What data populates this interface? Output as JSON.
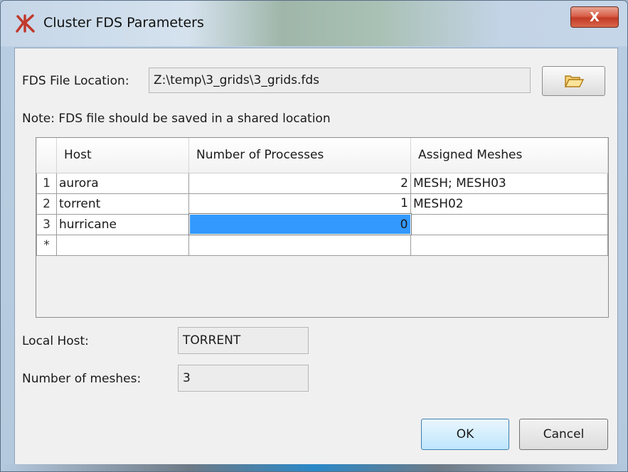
{
  "window": {
    "title": "Cluster FDS Parameters",
    "close_label": "X"
  },
  "fds_file": {
    "label": "FDS File Location:",
    "value": "Z:\\temp\\3_grids\\3_grids.fds",
    "browse_icon": "folder-open-icon"
  },
  "note": "Note: FDS file should be saved in a shared location",
  "table": {
    "columns": [
      "Host",
      "Number of Processes",
      "Assigned Meshes"
    ],
    "rows": [
      {
        "num": "1",
        "host": "aurora",
        "processes": "2",
        "meshes": "MESH; MESH03"
      },
      {
        "num": "2",
        "host": "torrent",
        "processes": "1",
        "meshes": "MESH02"
      },
      {
        "num": "3",
        "host": "hurricane",
        "processes": "0",
        "meshes": ""
      },
      {
        "num": "*",
        "host": "",
        "processes": "",
        "meshes": ""
      }
    ],
    "selected_row": 2
  },
  "local_host": {
    "label": "Local Host:",
    "value": "TORRENT"
  },
  "num_meshes": {
    "label": "Number of meshes:",
    "value": "3"
  },
  "buttons": {
    "ok": "OK",
    "cancel": "Cancel"
  },
  "colors": {
    "selection": "#3399ff",
    "close_button": "#c9412b"
  }
}
